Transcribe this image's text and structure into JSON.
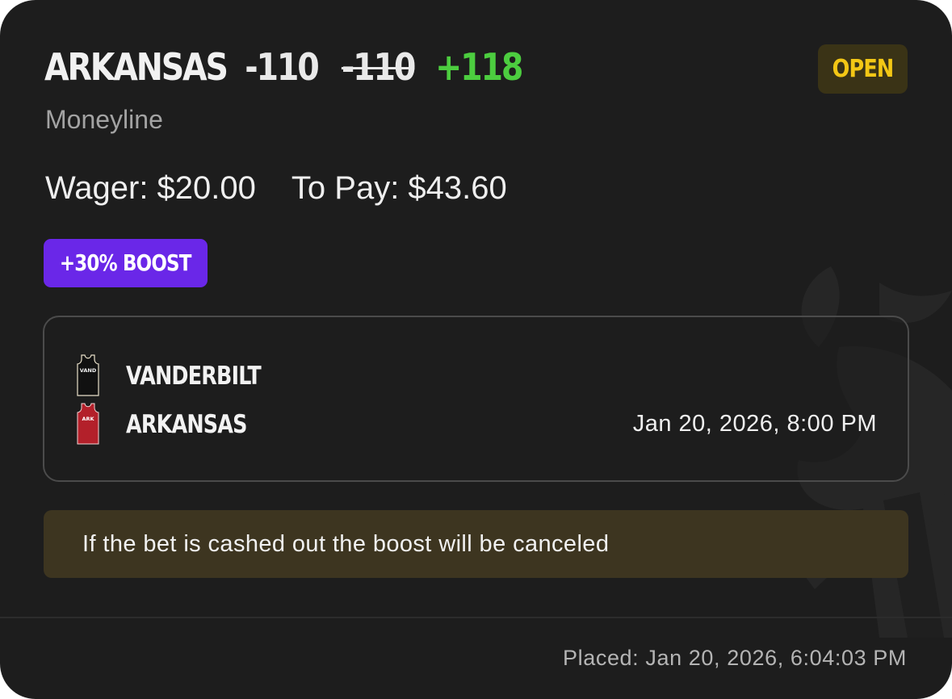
{
  "bet": {
    "team": "ARKANSAS",
    "odds": "-110",
    "odds_original": "-110",
    "odds_boosted": "+118",
    "bet_type": "Moneyline",
    "status": "OPEN",
    "wager_text": "Wager: $20.00",
    "to_pay_text": "To Pay: $43.60",
    "boost_label": "+30% BOOST"
  },
  "matchup": {
    "teams": [
      {
        "name": "VANDERBILT",
        "jersey_label": "VAND",
        "jersey_color": "#111111"
      },
      {
        "name": "ARKANSAS",
        "jersey_label": "ARK",
        "jersey_color": "#b3202a"
      }
    ],
    "game_time": "Jan 20, 2026, 8:00 PM"
  },
  "notice": "If the bet is cashed out the boost will be canceled",
  "placed": "Placed: Jan 20, 2026, 6:04:03 PM",
  "colors": {
    "card_bg": "#1d1d1d",
    "odds_green": "#4ccd3f",
    "status_yellow": "#f3c715",
    "boost_purple": "#6a27e8",
    "notice_bg": "#3d3520"
  }
}
